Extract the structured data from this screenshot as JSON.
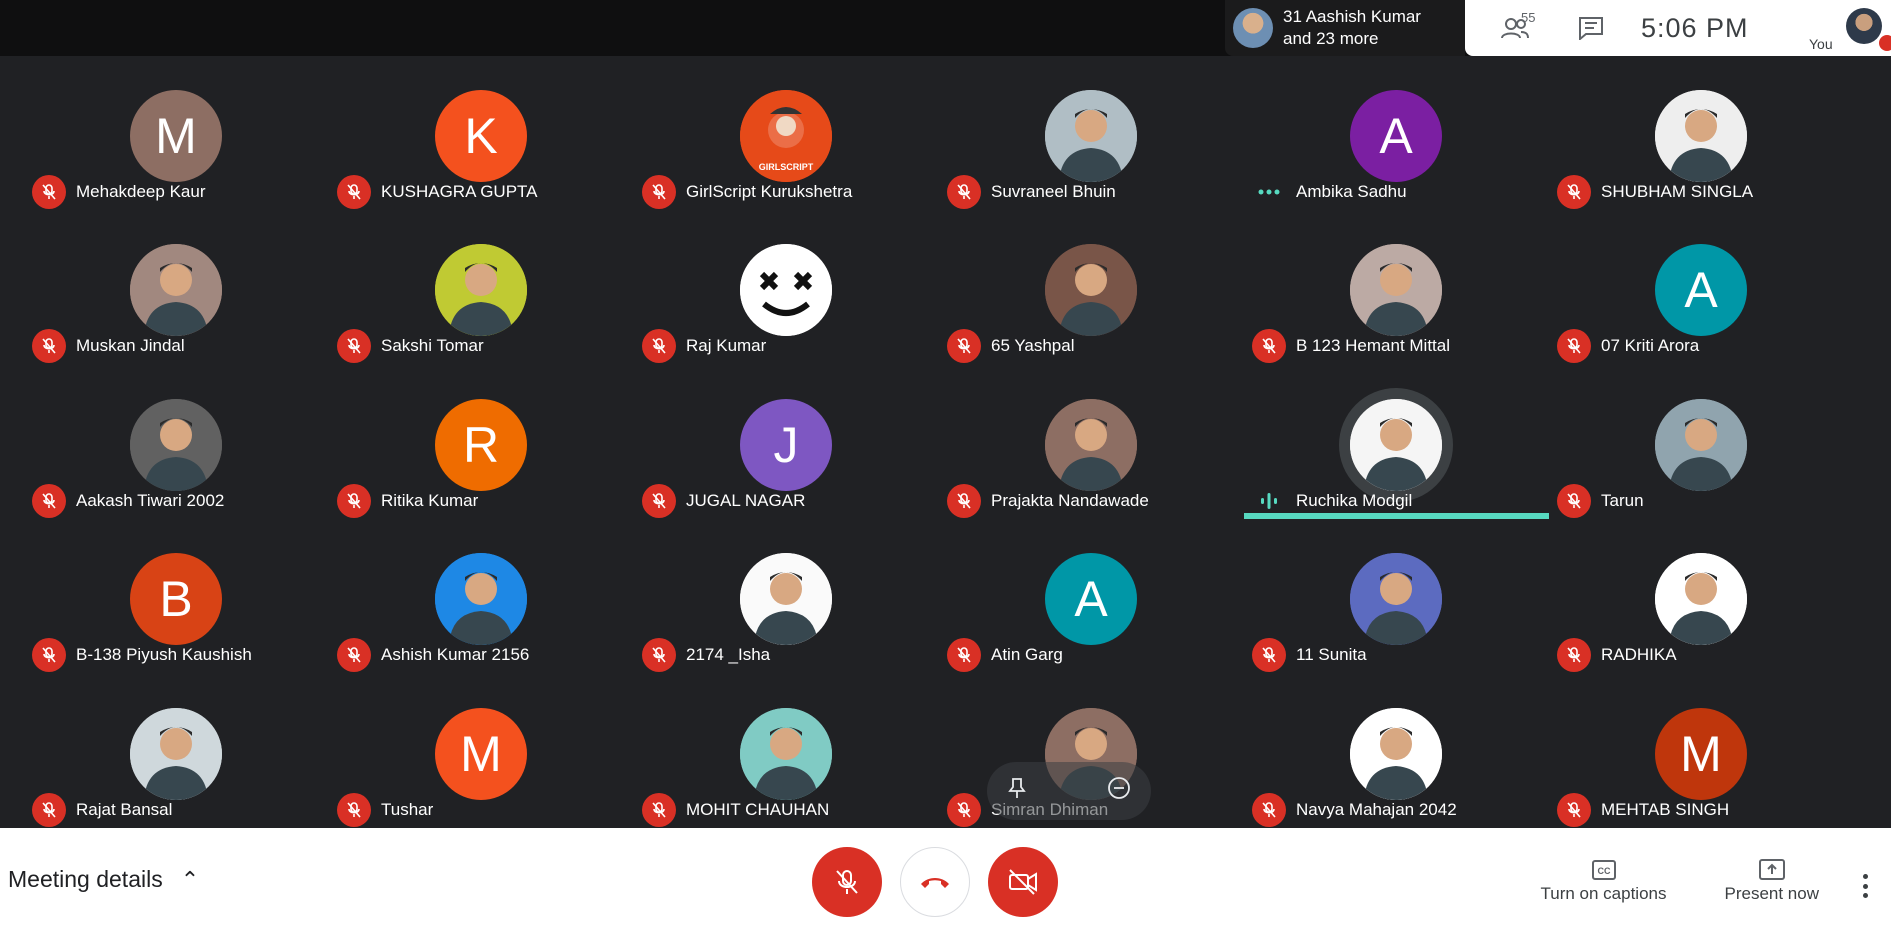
{
  "header": {
    "presenter_line1": "31 Aashish Kumar",
    "presenter_line2": "and 23 more",
    "people_count": "55",
    "clock": "5:06  PM",
    "you_label": "You"
  },
  "participants": [
    {
      "name": "Mehakdeep Kaur",
      "initial": "M",
      "color": "#8d6e63",
      "status": "muted"
    },
    {
      "name": "KUSHAGRA GUPTA",
      "initial": "K",
      "color": "#f4511e",
      "status": "muted"
    },
    {
      "name": "GirlScript Kurukshetra",
      "initial": "",
      "color": "#e64a19",
      "status": "muted",
      "photo": "logo"
    },
    {
      "name": "Suvraneel Bhuin",
      "initial": "",
      "color": "#b0bec5",
      "status": "muted",
      "photo": "photo"
    },
    {
      "name": "Ambika Sadhu",
      "initial": "A",
      "color": "#7b1fa2",
      "status": "connecting"
    },
    {
      "name": "SHUBHAM SINGLA",
      "initial": "",
      "color": "#eeeeee",
      "status": "muted",
      "photo": "photo"
    },
    {
      "name": "Muskan Jindal",
      "initial": "",
      "color": "#a1887f",
      "status": "muted",
      "photo": "photo"
    },
    {
      "name": "Sakshi Tomar",
      "initial": "",
      "color": "#c0ca33",
      "status": "muted",
      "photo": "photo"
    },
    {
      "name": "Raj Kumar",
      "initial": "",
      "color": "#ffffff",
      "status": "muted",
      "photo": "marshmello"
    },
    {
      "name": "65 Yashpal",
      "initial": "",
      "color": "#795548",
      "status": "muted",
      "photo": "photo"
    },
    {
      "name": "B 123 Hemant Mittal",
      "initial": "",
      "color": "#bcaaa4",
      "status": "muted",
      "photo": "photo"
    },
    {
      "name": "07 Kriti Arora",
      "initial": "A",
      "color": "#0097a7",
      "status": "muted"
    },
    {
      "name": "Aakash Tiwari 2002",
      "initial": "",
      "color": "#616161",
      "status": "muted",
      "photo": "photo"
    },
    {
      "name": "Ritika Kumar",
      "initial": "R",
      "color": "#ef6c00",
      "status": "muted"
    },
    {
      "name": "JUGAL NAGAR",
      "initial": "J",
      "color": "#7e57c2",
      "status": "muted"
    },
    {
      "name": "Prajakta Nandawade",
      "initial": "",
      "color": "#8d6e63",
      "status": "muted",
      "photo": "photo"
    },
    {
      "name": "Ruchika Modgil",
      "initial": "",
      "color": "#f5f5f5",
      "status": "speaking",
      "photo": "photo"
    },
    {
      "name": "Tarun",
      "initial": "",
      "color": "#90a4ae",
      "status": "muted",
      "photo": "photo"
    },
    {
      "name": "B-138 Piyush Kaushish",
      "initial": "B",
      "color": "#d84315",
      "status": "muted"
    },
    {
      "name": "Ashish Kumar 2156",
      "initial": "",
      "color": "#1e88e5",
      "status": "muted",
      "photo": "photo"
    },
    {
      "name": "2174 _Isha",
      "initial": "",
      "color": "#fafafa",
      "status": "muted",
      "photo": "photo"
    },
    {
      "name": "Atin Garg",
      "initial": "A",
      "color": "#0097a7",
      "status": "muted"
    },
    {
      "name": "11 Sunita",
      "initial": "",
      "color": "#5c6bc0",
      "status": "muted",
      "photo": "photo"
    },
    {
      "name": "RADHIKA",
      "initial": "",
      "color": "#ffffff",
      "status": "muted",
      "photo": "photo"
    },
    {
      "name": "Rajat Bansal",
      "initial": "",
      "color": "#cfd8dc",
      "status": "muted",
      "photo": "photo"
    },
    {
      "name": "Tushar",
      "initial": "M",
      "color": "#f4511e",
      "status": "muted"
    },
    {
      "name": "MOHIT CHAUHAN",
      "initial": "",
      "color": "#80cbc4",
      "status": "muted",
      "photo": "photo"
    },
    {
      "name": "Simran Dhiman",
      "initial": "",
      "color": "#8d6e63",
      "status": "muted",
      "photo": "photo",
      "hover": true
    },
    {
      "name": "Navya Mahajan 2042",
      "initial": "",
      "color": "#ffffff",
      "status": "muted",
      "photo": "photo"
    },
    {
      "name": "MEHTAB SINGH",
      "initial": "M",
      "color": "#bf360c",
      "status": "muted"
    }
  ],
  "bottombar": {
    "meeting_details": "Meeting details",
    "captions_label": "Turn on captions",
    "present_label": "Present now"
  },
  "colors": {
    "accent_red": "#d93025",
    "speaking": "#57d9c0"
  }
}
